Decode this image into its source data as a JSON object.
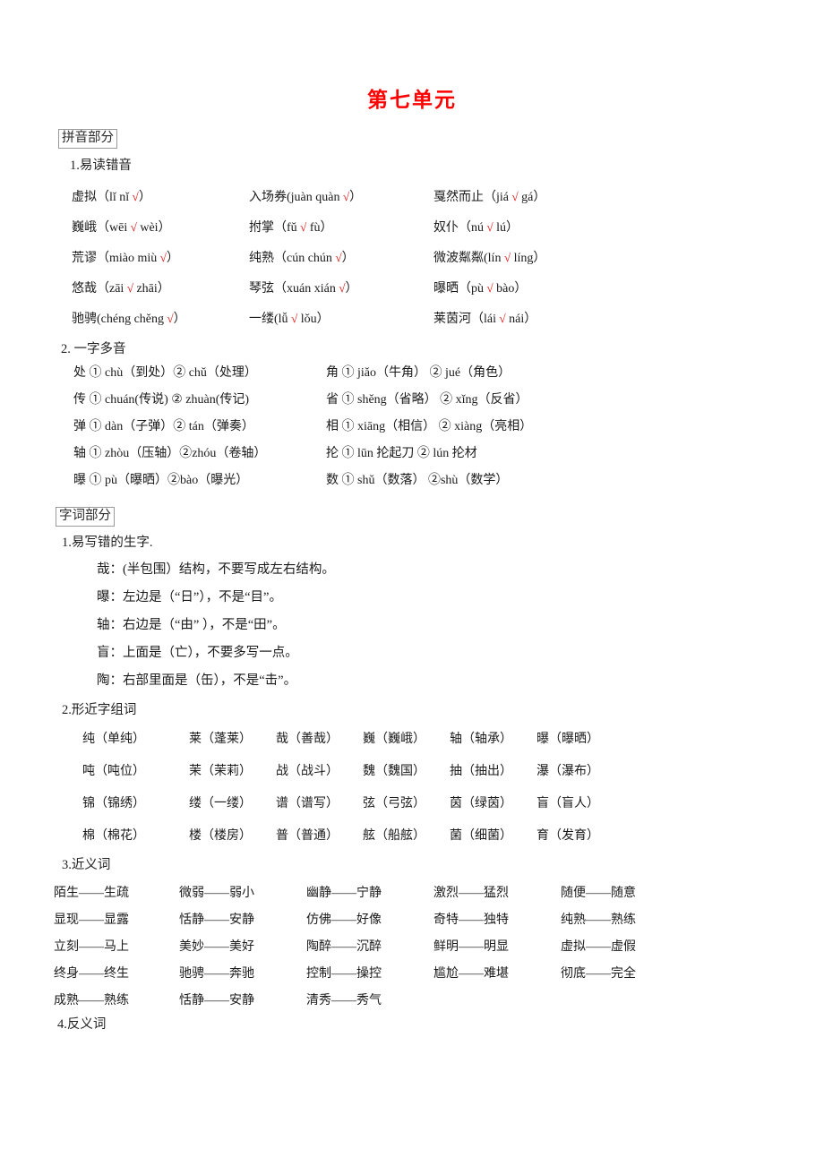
{
  "document": {
    "title": "第七单元",
    "title_color": "#ff0000"
  },
  "sections": {
    "pinyin_part": {
      "heading": "拼音部分",
      "sub1": {
        "heading": "1.易读错音",
        "rows": [
          [
            {
              "word": "虚拟（lǐ",
              "alt": "nǐ",
              "tick": "√",
              "close": "）"
            },
            {
              "word": "入场券(juàn",
              "alt": "quàn",
              "tick": "√",
              "close": "）"
            },
            {
              "word": "戛然而止（jiá",
              "tick": "√",
              "alt": "gá",
              "close": "）"
            }
          ],
          [
            {
              "word": "巍峨（wēi",
              "tick": "√",
              "alt": "wèi",
              "close": "）"
            },
            {
              "word": "拊掌（fǔ",
              "tick": "√",
              "alt": "fù",
              "close": "）"
            },
            {
              "word": "奴仆（nú",
              "tick": "√",
              "alt": "lú",
              "close": "）"
            }
          ],
          [
            {
              "word": "荒谬（miào",
              "alt": "miù",
              "tick": "√",
              "close": "）"
            },
            {
              "word": "纯熟（cún",
              "alt": "chún",
              "tick": "√",
              "close": "）"
            },
            {
              "word": "微波粼粼(lín",
              "tick": "√",
              "alt": "líng",
              "close": "）"
            }
          ],
          [
            {
              "word": "悠哉（zāi",
              "tick": "√",
              "alt": "zhāi",
              "close": "）"
            },
            {
              "word": "琴弦（xuán",
              "alt": "xián",
              "tick": "√",
              "close": "）"
            },
            {
              "word": "曝晒（pù",
              "tick": "√",
              "alt": "bào",
              "close": "）"
            }
          ],
          [
            {
              "word": "驰骋(chéng",
              "alt": "chěng",
              "tick": "√",
              "close": "）"
            },
            {
              "word": "一缕(lǚ",
              "tick": "√",
              "alt": "lǒu",
              "close": "）"
            },
            {
              "word": "莱茵河（lái",
              "tick": "√",
              "alt": "nái",
              "close": "）"
            }
          ]
        ],
        "rows_text": [
          [
            "虚拟（lǐ  nǐ √）",
            "入场券(juàn  quàn √）",
            "戛然而止（jiá √   gá）"
          ],
          [
            "巍峨（wēi √   wèi）",
            "拊掌（fǔ √   fù）",
            "奴仆（nú √   lú）"
          ],
          [
            "荒谬（miào  miù √）",
            "纯熟（cún  chún √）",
            "微波粼粼(lín √  líng）"
          ],
          [
            "悠哉（zāi √   zhāi）",
            "琴弦（xuán   xián √）",
            "曝晒（pù √   bào）"
          ],
          [
            "驰骋(chéng  chěng √）",
            "一缕(lǚ √   lǒu）",
            "莱茵河（lái √   nái）"
          ]
        ]
      },
      "sub2": {
        "heading": "2.  一字多音",
        "rows": [
          [
            "处 ① chù（到处）② chǔ（处理）",
            "角 ① jiǎo（牛角）   ②   jué（角色）"
          ],
          [
            "传 ① chuán(传说) ② zhuàn(传记)",
            "省 ① shěng（省略） ② xǐng（反省）"
          ],
          [
            "弹 ① dàn（子弹）② tán（弹奏）",
            "相 ① xiāng（相信） ②   xiàng（亮相）"
          ],
          [
            "轴 ① zhòu（压轴）②zhóu（卷轴）",
            "抡 ① lūn 抡起刀    ② lún 抡材"
          ],
          [
            "曝 ①  pù（曝晒）②bào（曝光）",
            "数 ① shǔ（数落）   ②shù（数学）"
          ]
        ]
      }
    },
    "zici_part": {
      "heading": "字词部分",
      "sub1": {
        "heading": "1.易写错的生字.",
        "lines": [
          "哉：(半包围）结构，不要写成左右结构。",
          "曝：左边是（“日”），不是“目”。",
          "轴：右边是（“由” ），不是“田”。",
          "盲：上面是（亡），不要多写一点。",
          "陶：右部里面是（缶），不是“击”。"
        ]
      },
      "sub2": {
        "heading": "2.形近字组词",
        "rows": [
          [
            "纯（单纯）",
            "莱（蓬莱）",
            "哉（善哉）",
            "巍（巍峨）",
            "轴（轴承）",
            "曝（曝晒）"
          ],
          [
            "吨（吨位）",
            "茉（茉莉）",
            "战（战斗）",
            "魏（魏国）",
            "抽（抽出）",
            "瀑（瀑布）"
          ],
          [
            "锦（锦绣）",
            "缕（一缕）",
            "谱（谱写）",
            "弦（弓弦）",
            "茵（绿茵）",
            "盲（盲人）"
          ],
          [
            "棉（棉花）",
            "楼（楼房）",
            "普（普通）",
            "舷（船舷）",
            "菌（细菌）",
            "育（发育）"
          ]
        ]
      },
      "sub3": {
        "heading": "3.近义词",
        "rows": [
          [
            "陌生——生疏",
            "微弱——弱小",
            "幽静——宁静",
            "激烈——猛烈",
            "随便——随意"
          ],
          [
            "显现——显露",
            "恬静——安静",
            "仿佛——好像",
            "奇特——独特",
            "纯熟——熟练"
          ],
          [
            "立刻——马上",
            "美妙——美好",
            "陶醉——沉醉",
            "鲜明——明显",
            "虚拟——虚假"
          ],
          [
            "终身——终生",
            "驰骋——奔驰",
            "控制——操控",
            "尴尬——难堪",
            "彻底——完全"
          ],
          [
            "成熟——熟练",
            "恬静——安静",
            "清秀——秀气",
            "",
            ""
          ]
        ]
      },
      "sub4": {
        "heading": "4.反义词"
      }
    }
  }
}
